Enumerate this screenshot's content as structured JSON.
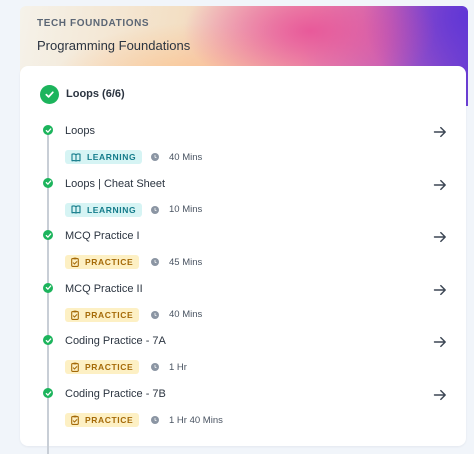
{
  "course": {
    "eyebrow": "TECH FOUNDATIONS",
    "title": "Programming Foundations"
  },
  "section": {
    "title": "Loops (6/6)"
  },
  "items": [
    {
      "title": "Loops",
      "type": "LEARNING",
      "duration": "40 Mins",
      "completed": true
    },
    {
      "title": "Loops | Cheat Sheet",
      "type": "LEARNING",
      "duration": "10 Mins",
      "completed": true
    },
    {
      "title": "MCQ Practice I",
      "type": "PRACTICE",
      "duration": "45 Mins",
      "completed": true
    },
    {
      "title": "MCQ Practice II",
      "type": "PRACTICE",
      "duration": "40 Mins",
      "completed": true
    },
    {
      "title": "Coding Practice - 7A",
      "type": "PRACTICE",
      "duration": "1 Hr",
      "completed": true
    },
    {
      "title": "Coding Practice - 7B",
      "type": "PRACTICE",
      "duration": "1 Hr 40 Mins",
      "completed": true
    }
  ],
  "colors": {
    "success": "#1cb45c",
    "learning_bg": "#d6f4f4",
    "learning_text": "#137b8a",
    "practice_bg": "#fdf0c4",
    "practice_text": "#a56a08"
  },
  "icons": {
    "learning": "book-icon",
    "practice": "clipboard-icon",
    "duration": "clock-icon",
    "open": "arrow-right-icon",
    "complete": "check-circle-icon"
  }
}
